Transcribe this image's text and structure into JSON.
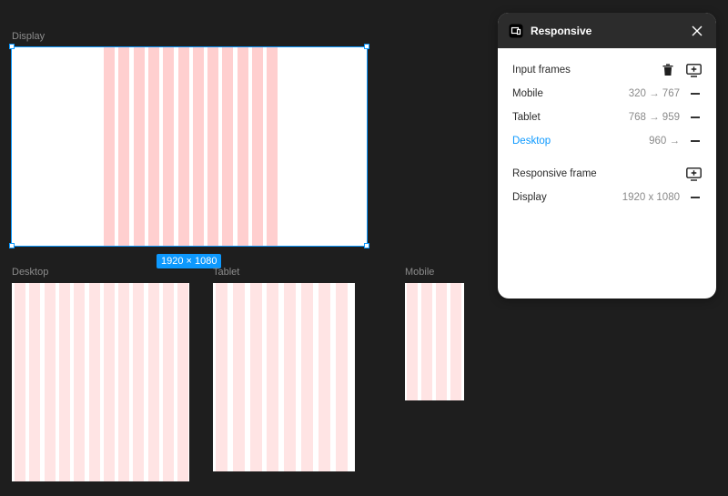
{
  "canvas": {
    "frames": [
      {
        "key": "display",
        "label": "Display"
      },
      {
        "key": "desktop",
        "label": "Desktop"
      },
      {
        "key": "tablet",
        "label": "Tablet"
      },
      {
        "key": "mobile",
        "label": "Mobile"
      }
    ],
    "selection_size": "1920 × 1080",
    "grid_color": "#ffcfcf",
    "grid_color_light": "#ffe4e4",
    "accent": "#0d99ff"
  },
  "panel": {
    "title": "Responsive",
    "input_frames": {
      "title": "Input frames",
      "items": [
        {
          "name": "Mobile",
          "range": "320 → 767",
          "active": false
        },
        {
          "name": "Tablet",
          "range": "768 → 959",
          "active": false
        },
        {
          "name": "Desktop",
          "range": "960 →",
          "active": true
        }
      ]
    },
    "responsive_frame": {
      "title": "Responsive frame",
      "items": [
        {
          "name": "Display",
          "range": "1920 x 1080"
        }
      ]
    }
  }
}
